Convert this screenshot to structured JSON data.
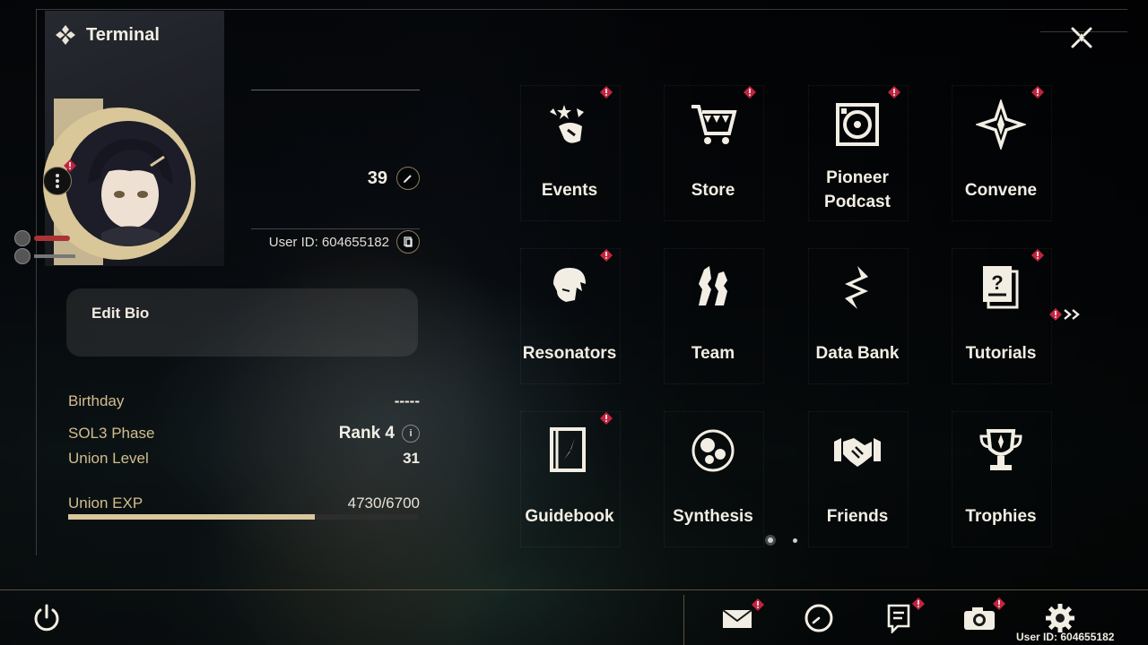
{
  "header": {
    "title": "Terminal"
  },
  "profile": {
    "level": "39",
    "user_id": "User ID: 604655182",
    "bio_label": "Edit Bio",
    "stats": {
      "birthday_label": "Birthday",
      "birthday_value": "-----",
      "phase_label": "SOL3 Phase",
      "phase_value": "Rank 4",
      "union_level_label": "Union Level",
      "union_level_value": "31",
      "union_exp_label": "Union EXP",
      "union_exp_value": "4730/6700",
      "union_exp_fraction": 0.706
    }
  },
  "menu": {
    "items": [
      {
        "label": "Events",
        "icon": "events-icon",
        "badge": true
      },
      {
        "label": "Store",
        "icon": "cart-icon",
        "badge": true
      },
      {
        "label": "Pioneer\nPodcast",
        "icon": "podcast-icon",
        "badge": true
      },
      {
        "label": "Convene",
        "icon": "convene-icon",
        "badge": true
      },
      {
        "label": "Resonators",
        "icon": "resonator-icon",
        "badge": true
      },
      {
        "label": "Team",
        "icon": "team-icon",
        "badge": false
      },
      {
        "label": "Data Bank",
        "icon": "data-bank-icon",
        "badge": false
      },
      {
        "label": "Tutorials",
        "icon": "tutorials-icon",
        "badge": true
      },
      {
        "label": "Guidebook",
        "icon": "guidebook-icon",
        "badge": true
      },
      {
        "label": "Synthesis",
        "icon": "synthesis-icon",
        "badge": false
      },
      {
        "label": "Friends",
        "icon": "friends-icon",
        "badge": false
      },
      {
        "label": "Trophies",
        "icon": "trophy-icon",
        "badge": false
      }
    ]
  },
  "bottom_bar": {
    "user_id": "User ID: 604655182",
    "buttons": [
      "mail-icon",
      "clock-icon",
      "notice-icon",
      "camera-icon",
      "settings-icon"
    ]
  },
  "colors": {
    "accent": "#d8c69c",
    "badge": "#c2243f",
    "text": "#f2eee4"
  }
}
